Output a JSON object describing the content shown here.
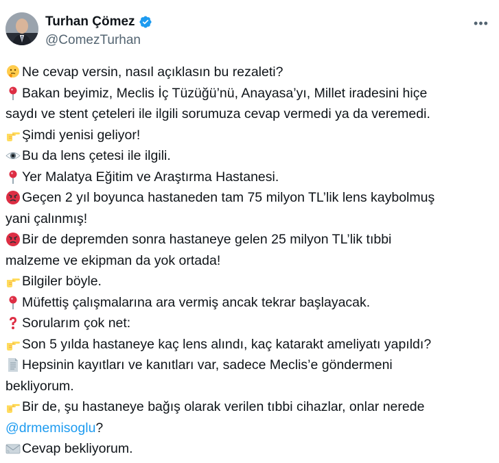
{
  "author": {
    "name": "Turhan Çömez",
    "handle": "@ComezTurhan"
  },
  "lines": [
    {
      "emoji": "thinking-face-icon",
      "text": "Ne cevap versin, nasıl açıklasın bu rezaleti?"
    },
    {
      "emoji": "round-pushpin-icon",
      "text": "Bakan beyimiz, Meclis İç Tüzüğü’nü, Anayasa’yı, Millet iradesini hiçe"
    },
    {
      "emoji": "",
      "text": "saydı ve stent çeteleri ile ilgili sorumuza cevap vermedi ya da veremedi."
    },
    {
      "emoji": "pointing-hand-icon",
      "text": "Şimdi yenisi geliyor!"
    },
    {
      "emoji": "eye-icon",
      "text": "Bu da lens çetesi ile ilgili."
    },
    {
      "emoji": "round-pushpin-icon",
      "text": "Yer Malatya Eğitim ve Araştırma Hastanesi."
    },
    {
      "emoji": "angry-face-icon",
      "text": "Geçen 2 yıl boyunca hastaneden tam 75 milyon TL’lik lens kaybolmuş"
    },
    {
      "emoji": "",
      "text": "yani çalınmış!"
    },
    {
      "emoji": "angry-face-icon",
      "text": "Bir de depremden sonra hastaneye gelen 25 milyon TL’lik tıbbi"
    },
    {
      "emoji": "",
      "text": "malzeme ve ekipman da yok ortada!"
    },
    {
      "emoji": "pointing-hand-icon",
      "text": "Bilgiler böyle."
    },
    {
      "emoji": "round-pushpin-icon",
      "text": "Müfettiş çalışmalarına ara vermiş ancak tekrar başlayacak."
    },
    {
      "emoji": "question-mark-icon",
      "text": "Sorularım çok net:"
    },
    {
      "emoji": "pointing-hand-icon",
      "text": "Son 5 yılda hastaneye kaç lens alındı, kaç katarakt ameliyatı yapıldı?"
    },
    {
      "emoji": "page-icon",
      "text": "Hepsinin kayıtları ve kanıtları var, sadece Meclis’e göndermeni"
    },
    {
      "emoji": "",
      "text": "bekliyorum."
    },
    {
      "emoji": "pointing-hand-icon",
      "text": "Bir de, şu hastaneye bağış olarak verilen tıbbi cihazlar, onlar nerede"
    },
    {
      "emoji": "",
      "text": "@drmemisoglu",
      "suffix": " ?",
      "mention": true
    },
    {
      "emoji": "envelope-icon",
      "text": "Cevap bekliyorum."
    }
  ],
  "colors": {
    "text": "#0f1419",
    "secondary": "#536471",
    "link": "#1d9bf0",
    "verified": "#1d9bf0"
  }
}
